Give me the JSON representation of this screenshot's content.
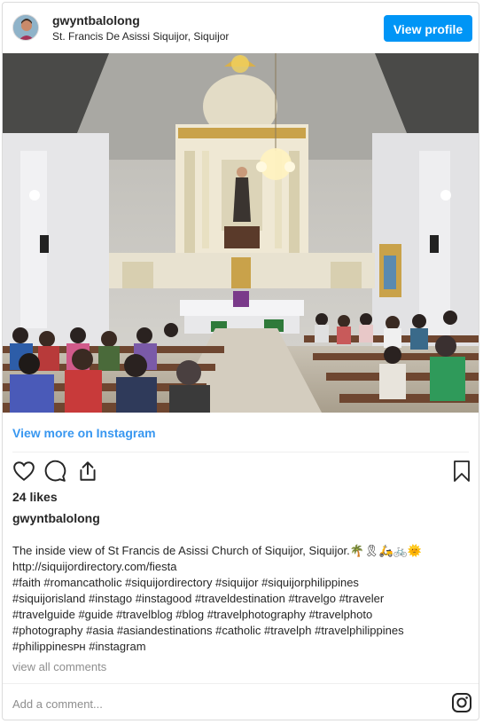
{
  "header": {
    "username": "gwyntbalolong",
    "location": "St. Francis De Asissi Siquijor, Siquijor",
    "view_profile_label": "View profile"
  },
  "post": {
    "image_alt": "Interior of St Francis de Asissi Church with congregation during mass",
    "view_more_label": "View more on Instagram",
    "likes": "24 likes",
    "caption_username": "gwyntbalolong",
    "caption_lines": [
      "The inside view of St Francis de Asissi Church of Siquijor, Siquijor.🌴🎗🛵🚲🌞",
      "http://siquijordirectory.com/fiesta",
      "#faith #romancatholic #siquijordirectory #siquijor #siquijorphilippines",
      "#siquijorisland #instago #instagood #traveldestination #travelgo #traveler",
      "#travelguide #guide #travelblog #blog #travelphotography #travelphoto",
      "#photography #asia #asiandestinations #catholic #travelph #travelphilippines",
      "#philippinesᴘʜ #instagram"
    ],
    "view_all_comments": "view all comments",
    "add_comment_placeholder": "Add a comment..."
  },
  "icons": [
    "heart-icon",
    "comment-icon",
    "share-icon",
    "bookmark-icon",
    "instagram-icon"
  ],
  "colors": {
    "accent": "#0095f6",
    "link": "#3897f0",
    "muted": "#8e8e8e",
    "border": "#dbdbdb"
  }
}
